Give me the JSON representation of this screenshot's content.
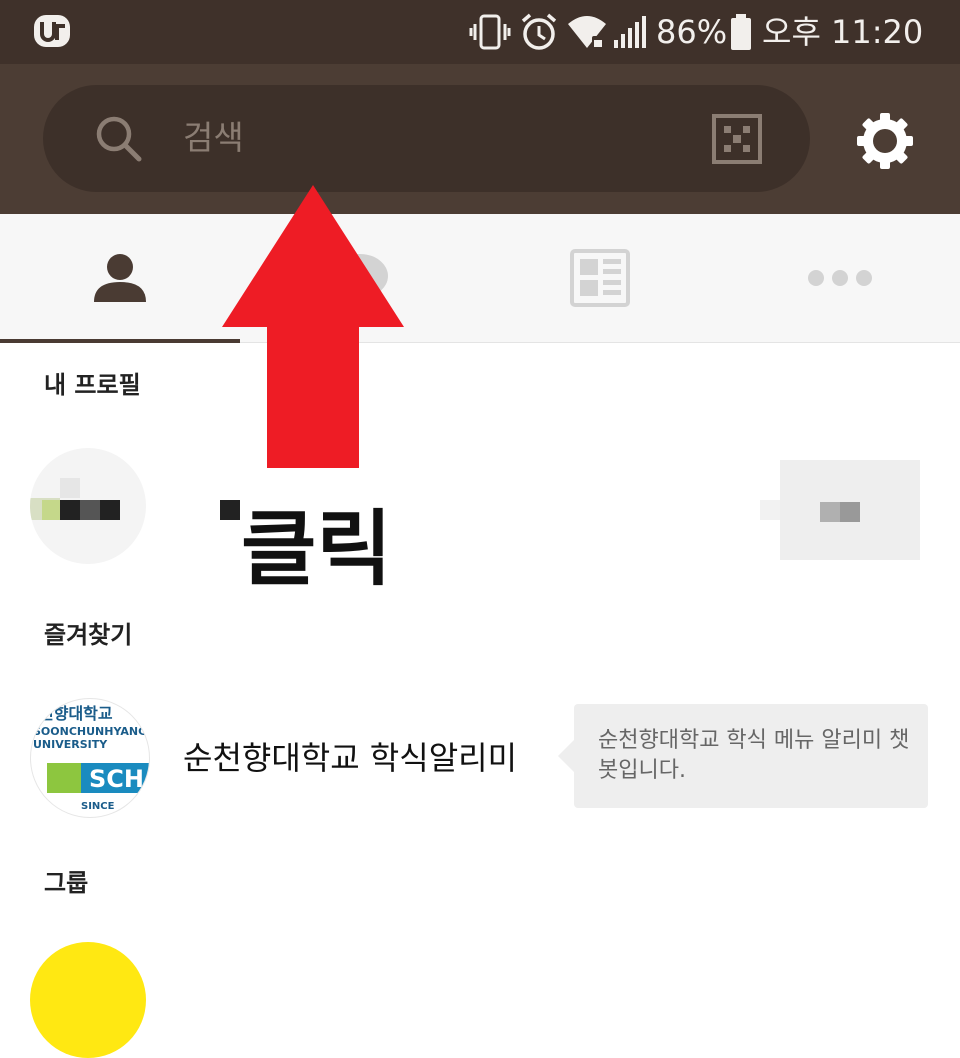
{
  "status_bar": {
    "battery_percent": "86%",
    "time": "오후 11:20",
    "icons": [
      "carrier-logo-icon",
      "vibrate-icon",
      "alarm-icon",
      "wifi-icon",
      "signal-icon",
      "battery-icon"
    ]
  },
  "header": {
    "search_placeholder": "검색",
    "icons": [
      "search-icon",
      "qr-code-icon",
      "settings-icon"
    ]
  },
  "tabs": [
    {
      "icon": "friends-icon",
      "active": true
    },
    {
      "icon": "chat-icon",
      "active": false
    },
    {
      "icon": "news-icon",
      "active": false
    },
    {
      "icon": "more-icon",
      "active": false
    }
  ],
  "sections": {
    "my_profile": "내 프로필",
    "favorites": "즐겨찾기",
    "groups": "그룹"
  },
  "annotation": {
    "click_label": "클릭",
    "arrow_color": "#ee1c25"
  },
  "favorites": [
    {
      "name": "순천향대학교 학식알리미",
      "description": "순천향대학교 학식 메뉴 알리미 챗봇입니다.",
      "logo_text_1": "천향대학교",
      "logo_text_2": "SOONCHUNHYANG",
      "logo_text_3": "UNIVERSITY",
      "logo_text_4": "SCH",
      "logo_text_5": "SINCE"
    }
  ],
  "colors": {
    "status_bar": "#3f312a",
    "header": "#4c3d34",
    "accent_group": "#ffe812"
  }
}
